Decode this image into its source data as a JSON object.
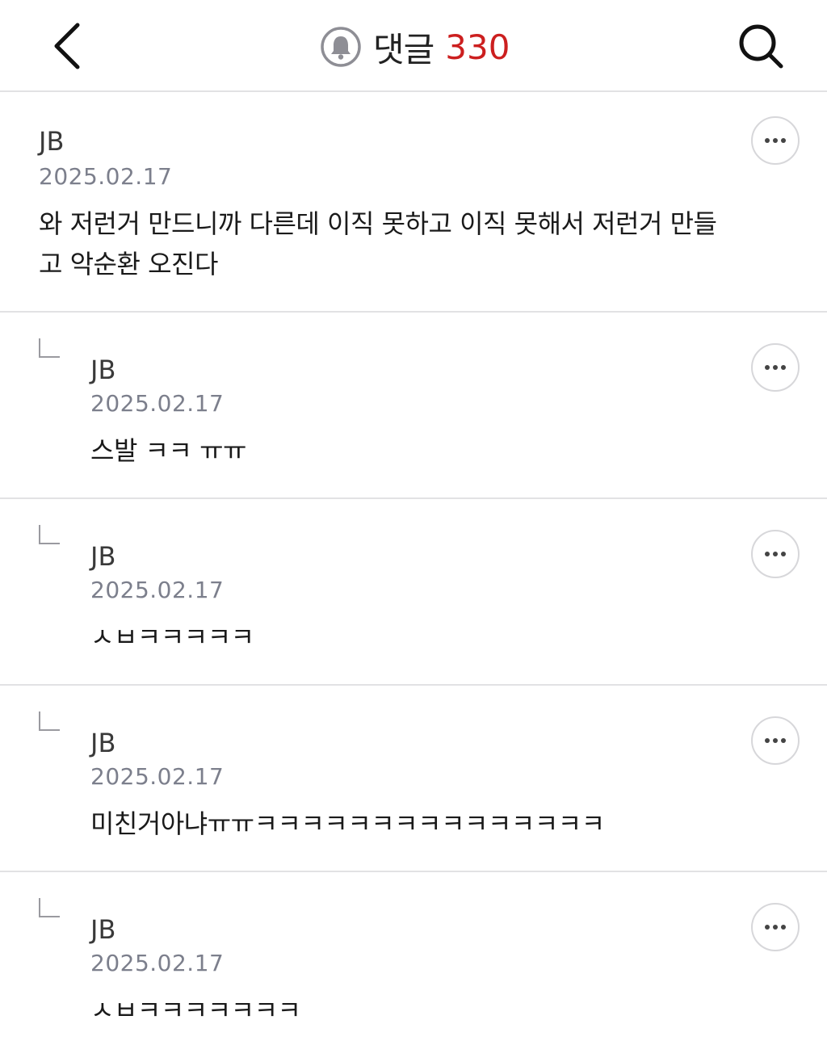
{
  "header": {
    "back_icon": "chevron-left-icon",
    "notify_icon": "bell-icon",
    "title": "댓글",
    "count": "330",
    "search_icon": "search-icon"
  },
  "comments": [
    {
      "author": "JB",
      "date": "2025.02.17",
      "text_lines": [
        "와 저런거 만드니까 다른데 이직 못하고 이직 못해서 저런거 만들",
        "고 악순환 오진다"
      ],
      "is_reply": false
    },
    {
      "author": "JB",
      "date": "2025.02.17",
      "text_lines": [
        "스발 ㅋㅋ ㅠㅠ"
      ],
      "is_reply": true
    },
    {
      "author": "JB",
      "date": "2025.02.17",
      "text_lines": [
        "ㅅㅂㅋㅋㅋㅋㅋ"
      ],
      "is_reply": true
    },
    {
      "author": "JB",
      "date": "2025.02.17",
      "text_lines": [
        "미친거아냐ㅠㅠㅋㅋㅋㅋㅋㅋㅋㅋㅋㅋㅋㅋㅋㅋㅋ"
      ],
      "is_reply": true
    },
    {
      "author": "JB",
      "date": "2025.02.17",
      "text_lines": [
        "ㅅㅂㅋㅋㅋㅋㅋㅋㅋ"
      ],
      "is_reply": true
    }
  ],
  "colors": {
    "accent_red": "#cc1f1f",
    "date_gray": "#7c7f8c",
    "divider": "#e2e2e4"
  }
}
